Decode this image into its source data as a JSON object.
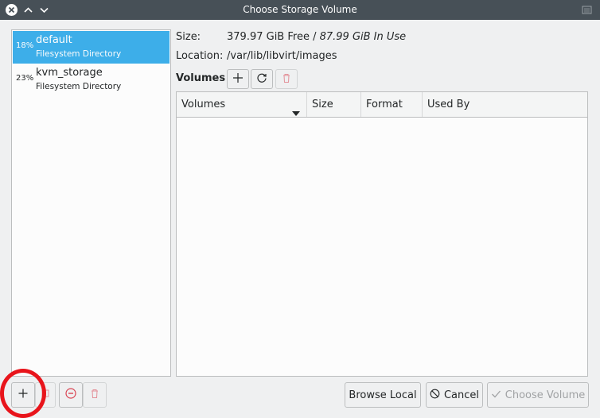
{
  "window": {
    "title": "Choose Storage Volume",
    "icons": {
      "close": "close-circle-icon",
      "up": "chevron-up-icon",
      "down": "chevron-down-icon",
      "right": "window-menu-icon"
    }
  },
  "pools": [
    {
      "percent": "18%",
      "name": "default",
      "type": "Filesystem Directory",
      "selected": true
    },
    {
      "percent": "23%",
      "name": "kvm_storage",
      "type": "Filesystem Directory",
      "selected": false
    }
  ],
  "info": {
    "size_label": "Size:",
    "size_free": "379.97 GiB Free / ",
    "size_used": "87.99 GiB In Use",
    "location_label": "Location:",
    "location_value": "/var/lib/libvirt/images"
  },
  "volumes": {
    "heading": "Volumes",
    "columns": [
      "Volumes",
      "Size",
      "Format",
      "Used By"
    ],
    "rows": []
  },
  "buttons": {
    "browse_local": "Browse Local",
    "cancel": "Cancel",
    "choose_volume": "Choose Volume"
  },
  "colors": {
    "selection": "#3daee9",
    "titlebar": "#475057",
    "highlight_ring": "#e8141b",
    "delete_red": "#da4453"
  }
}
